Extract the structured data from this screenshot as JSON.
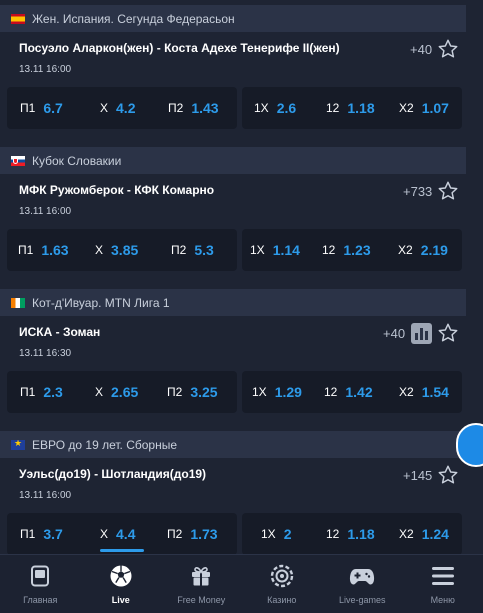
{
  "leagues": [
    {
      "name": "Жен. Испания. Сегунда Федерасьон",
      "match": {
        "teams": "Посуэло Аларкон(жен) - Коста Адехе Тенерифе II(жен)",
        "datetime": "13.11 16:00",
        "more": "+40",
        "odds_main": [
          {
            "label": "П1",
            "value": "6.7"
          },
          {
            "label": "Х",
            "value": "4.2"
          },
          {
            "label": "П2",
            "value": "1.43"
          }
        ],
        "odds_double": [
          {
            "label": "1Х",
            "value": "2.6"
          },
          {
            "label": "12",
            "value": "1.18"
          },
          {
            "label": "Х2",
            "value": "1.07"
          }
        ]
      }
    },
    {
      "name": "Кубок Словакии",
      "match": {
        "teams": "МФК Ружомберок - КФК Комарно",
        "datetime": "13.11 16:00",
        "more": "+733",
        "odds_main": [
          {
            "label": "П1",
            "value": "1.63"
          },
          {
            "label": "Х",
            "value": "3.85"
          },
          {
            "label": "П2",
            "value": "5.3"
          }
        ],
        "odds_double": [
          {
            "label": "1Х",
            "value": "1.14"
          },
          {
            "label": "12",
            "value": "1.23"
          },
          {
            "label": "Х2",
            "value": "2.19"
          }
        ]
      }
    },
    {
      "name": "Кот-д'Ивуар. MTN Лига 1",
      "match": {
        "teams": "ИСКА - Зоман",
        "datetime": "13.11 16:30",
        "more": "+40",
        "odds_main": [
          {
            "label": "П1",
            "value": "2.3"
          },
          {
            "label": "Х",
            "value": "2.65"
          },
          {
            "label": "П2",
            "value": "3.25"
          }
        ],
        "odds_double": [
          {
            "label": "1Х",
            "value": "1.29"
          },
          {
            "label": "12",
            "value": "1.42"
          },
          {
            "label": "Х2",
            "value": "1.54"
          }
        ]
      }
    },
    {
      "name": "ЕВРО до 19 лет. Сборные",
      "match": {
        "teams": "Уэльс(до19) - Шотландия(до19)",
        "datetime": "13.11 16:00",
        "more": "+145",
        "odds_main": [
          {
            "label": "П1",
            "value": "3.7"
          },
          {
            "label": "Х",
            "value": "4.4"
          },
          {
            "label": "П2",
            "value": "1.73"
          }
        ],
        "odds_double": [
          {
            "label": "1Х",
            "value": "2"
          },
          {
            "label": "12",
            "value": "1.18"
          },
          {
            "label": "Х2",
            "value": "1.24"
          }
        ]
      }
    }
  ],
  "nav": [
    {
      "label": "Главная",
      "icon": "home-icon"
    },
    {
      "label": "Live",
      "icon": "soccer-ball-icon"
    },
    {
      "label": "Free Money",
      "icon": "gift-icon"
    },
    {
      "label": "Казино",
      "icon": "casino-chip-icon"
    },
    {
      "label": "Live-games",
      "icon": "gamepad-icon"
    },
    {
      "label": "Меню",
      "icon": "menu-icon"
    }
  ],
  "colors": {
    "accent": "#2d9bea",
    "background": "#1e2433",
    "header": "#2b3347",
    "odds_bg": "#161b27"
  }
}
